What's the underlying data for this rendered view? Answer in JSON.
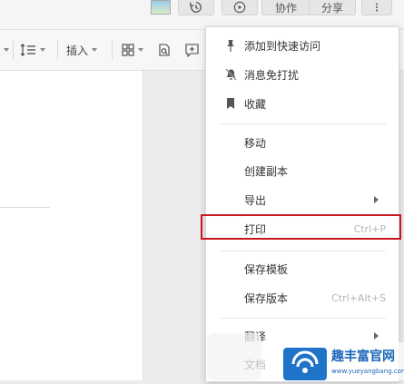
{
  "header": {
    "collab_label": "协作",
    "share_label": "分享"
  },
  "toolbar": {
    "insert_label": "插入"
  },
  "menu": {
    "items": [
      {
        "label": "添加到快速访问",
        "icon": "pin-icon"
      },
      {
        "label": "消息免打扰",
        "icon": "bell-off-icon"
      },
      {
        "label": "收藏",
        "icon": "bookmark-icon"
      },
      {
        "label": "移动"
      },
      {
        "label": "创建副本"
      },
      {
        "label": "导出",
        "submenu": true
      },
      {
        "label": "打印",
        "shortcut": "Ctrl+P"
      },
      {
        "label": "保存模板"
      },
      {
        "label": "保存版本",
        "shortcut": "Ctrl+Alt+S"
      },
      {
        "label": "翻译",
        "submenu": true
      },
      {
        "label": "文档"
      }
    ],
    "highlight_color": "#c9151e"
  },
  "watermark": {
    "title": "趣丰富官网",
    "url": "www.yueyangbang.com"
  }
}
